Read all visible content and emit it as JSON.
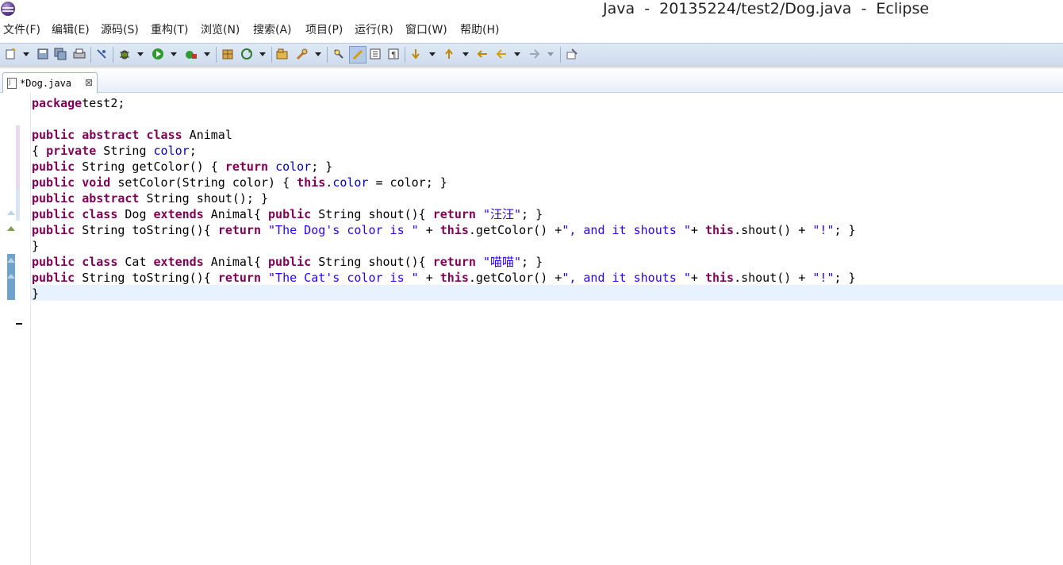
{
  "window": {
    "title": "Java  -  20135224/test2/Dog.java  -  Eclipse"
  },
  "menu": [
    "文件(F)",
    "编辑(E)",
    "源码(S)",
    "重构(T)",
    "浏览(N)",
    "搜索(A)",
    "项目(P)",
    "运行(R)",
    "窗口(W)",
    "帮助(H)"
  ],
  "editor": {
    "tab_label": "*Dog.java",
    "close_glyph": "⊠",
    "lines": [
      [
        [
          "kw",
          "package"
        ],
        [
          "",
          "test2;"
        ]
      ],
      [],
      [
        [
          "kw",
          "public abstract class"
        ],
        [
          "",
          " Animal"
        ]
      ],
      [
        [
          "",
          "{ "
        ],
        [
          "kw",
          "private"
        ],
        [
          "",
          " String "
        ],
        [
          "fld",
          "color"
        ],
        [
          "",
          ";"
        ]
      ],
      [
        [
          "kw",
          "public"
        ],
        [
          "",
          " String getColor() { "
        ],
        [
          "kw",
          "return"
        ],
        [
          "",
          " "
        ],
        [
          "fld",
          "color"
        ],
        [
          "",
          "; }"
        ]
      ],
      [
        [
          "kw",
          "public void"
        ],
        [
          "",
          " setColor(String color) { "
        ],
        [
          "kw",
          "this"
        ],
        [
          "",
          "."
        ],
        [
          "fld",
          "color"
        ],
        [
          "",
          " = color; }"
        ]
      ],
      [
        [
          "kw",
          "public abstract"
        ],
        [
          "",
          " String shout(); }"
        ]
      ],
      [
        [
          "kw",
          "public class"
        ],
        [
          "",
          " Dog "
        ],
        [
          "kw",
          "extends"
        ],
        [
          "",
          " Animal{ "
        ],
        [
          "kw",
          "public"
        ],
        [
          "",
          " String shout(){ "
        ],
        [
          "kw",
          "return"
        ],
        [
          "",
          " "
        ],
        [
          "str",
          "\"汪汪\""
        ],
        [
          "",
          "; }"
        ]
      ],
      [
        [
          "kw",
          "public"
        ],
        [
          "",
          " String toString(){ "
        ],
        [
          "kw",
          "return"
        ],
        [
          "",
          " "
        ],
        [
          "str",
          "\"The Dog's color is \""
        ],
        [
          "",
          " + "
        ],
        [
          "kw",
          "this"
        ],
        [
          "",
          ".getColor() +"
        ],
        [
          "str",
          "\", and it shouts \""
        ],
        [
          "",
          "+ "
        ],
        [
          "kw",
          "this"
        ],
        [
          "",
          ".shout() + "
        ],
        [
          "str",
          "\"!\""
        ],
        [
          "",
          "; }"
        ]
      ],
      [
        [
          "",
          "}"
        ]
      ],
      [
        [
          "kw",
          "public class"
        ],
        [
          "",
          " Cat "
        ],
        [
          "kw",
          "extends"
        ],
        [
          "",
          " Animal{ "
        ],
        [
          "kw",
          "public"
        ],
        [
          "",
          " String shout(){ "
        ],
        [
          "kw",
          "return"
        ],
        [
          "",
          " "
        ],
        [
          "str",
          "\"喵喵\""
        ],
        [
          "",
          "; }"
        ]
      ],
      [
        [
          "kw",
          "public"
        ],
        [
          "",
          " String toString(){ "
        ],
        [
          "kw",
          "return"
        ],
        [
          "",
          " "
        ],
        [
          "str",
          "\"The Cat's color is \""
        ],
        [
          "",
          " + "
        ],
        [
          "kw",
          "this"
        ],
        [
          "",
          ".getColor() +"
        ],
        [
          "str",
          "\", and it shouts \""
        ],
        [
          "",
          "+ "
        ],
        [
          "kw",
          "this"
        ],
        [
          "",
          ".shout() + "
        ],
        [
          "str",
          "\"!\""
        ],
        [
          "",
          "; }"
        ]
      ],
      [
        [
          "",
          "}"
        ]
      ]
    ]
  },
  "colors": {
    "keyword": "#7f0055",
    "string": "#2a00ff",
    "field": "#0000c0",
    "toolbar_bg": "#dfe9f5",
    "current_line": "#e8f2fe"
  },
  "toolbar_icons": [
    "new-icon",
    "save-icon",
    "save-all-icon",
    "print-icon",
    "toggle-breakpoint-icon",
    "debug-icon",
    "run-icon",
    "external-tools-icon",
    "new-package-icon",
    "refresh-icon",
    "open-type-icon",
    "search-icon",
    "toggle-mark-occurrences-icon",
    "highlight-icon",
    "block-selection-icon",
    "show-whitespace-icon",
    "next-annotation-icon",
    "previous-annotation-icon",
    "last-edit-icon",
    "back-icon",
    "forward-icon",
    "pin-editor-icon"
  ]
}
